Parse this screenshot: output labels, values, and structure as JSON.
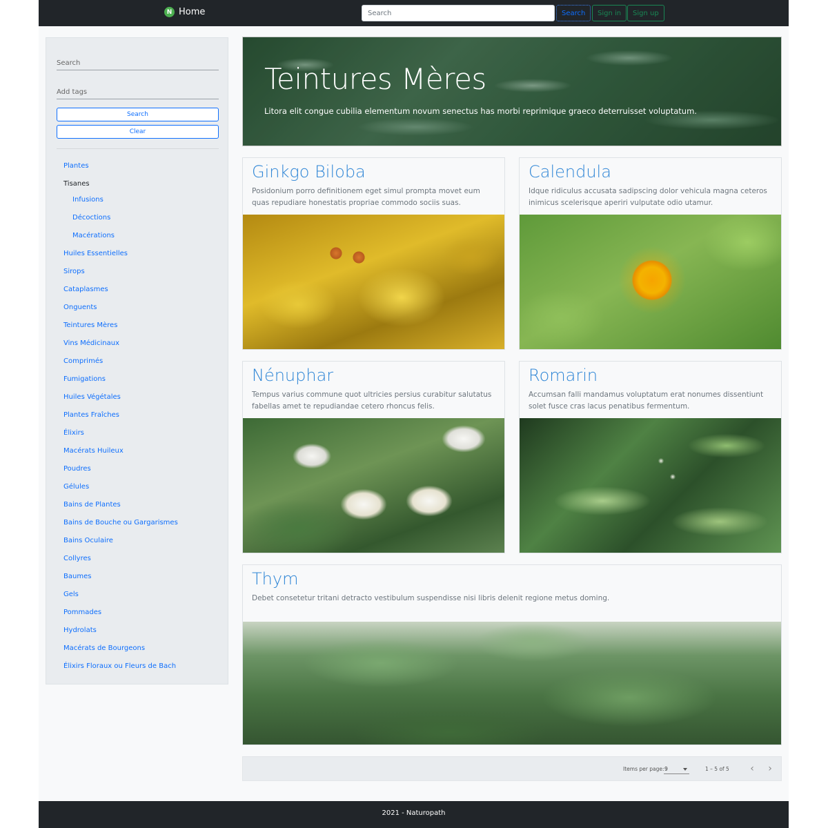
{
  "navbar": {
    "brand_logo_letter": "N",
    "brand_label": "Home",
    "search_placeholder": "Search",
    "search_button": "Search",
    "signin_button": "Sign in",
    "signup_button": "Sign up"
  },
  "sidebar": {
    "search_placeholder": "Search",
    "tags_placeholder": "Add tags",
    "search_button": "Search",
    "clear_button": "Clear",
    "items": [
      {
        "label": "Plantes"
      },
      {
        "label": "Tisanes"
      },
      {
        "label": "Infusions"
      },
      {
        "label": "Décoctions"
      },
      {
        "label": "Macérations"
      },
      {
        "label": "Huiles Essentielles"
      },
      {
        "label": "Sirops"
      },
      {
        "label": "Cataplasmes"
      },
      {
        "label": "Onguents"
      },
      {
        "label": "Teintures Mères"
      },
      {
        "label": "Vins Médicinaux"
      },
      {
        "label": "Comprimés"
      },
      {
        "label": "Fumigations"
      },
      {
        "label": "Huiles Végétales"
      },
      {
        "label": "Plantes Fraîches"
      },
      {
        "label": "Élixirs"
      },
      {
        "label": "Macérats Huileux"
      },
      {
        "label": "Poudres"
      },
      {
        "label": "Gélules"
      },
      {
        "label": "Bains de Plantes"
      },
      {
        "label": "Bains de Bouche ou Gargarismes"
      },
      {
        "label": "Bains Oculaire"
      },
      {
        "label": "Collyres"
      },
      {
        "label": "Baumes"
      },
      {
        "label": "Gels"
      },
      {
        "label": "Pommades"
      },
      {
        "label": "Hydrolats"
      },
      {
        "label": "Macérats de Bourgeons"
      },
      {
        "label": "Élixirs Floraux ou Fleurs de Bach"
      }
    ]
  },
  "hero": {
    "title": "Teintures Mères",
    "text": "Litora elit congue cubilia elementum novum senectus has morbi reprimique graeco deterruisset voluptatum."
  },
  "cards": [
    {
      "title": "Ginkgo Biloba",
      "text": "Posidonium porro definitionem eget simul prompta movet eum quas repudiare honestatis propriae commodo sociis suas."
    },
    {
      "title": "Calendula",
      "text": "Idque ridiculus accusata sadipscing dolor vehicula magna ceteros inimicus scelerisque aperiri vulputate odio utamur."
    },
    {
      "title": "Nénuphar",
      "text": "Tempus varius commune quot ultricies persius curabitur salutatus fabellas amet te repudiandae cetero rhoncus felis."
    },
    {
      "title": "Romarin",
      "text": "Accumsan falli mandamus voluptatum erat nonumes dissentiunt solet fusce cras lacus penatibus fermentum."
    },
    {
      "title": "Thym",
      "text": "Debet consetetur tritani detracto vestibulum suspendisse nisi libris delenit regione metus doming."
    }
  ],
  "paginator": {
    "items_per_page_label": "Items per page:",
    "items_per_page_value": "9",
    "range_label": "1 – 5 of 5",
    "prev_icon": "‹",
    "next_icon": "›"
  },
  "footer": {
    "text": "2021 - Naturopath"
  }
}
